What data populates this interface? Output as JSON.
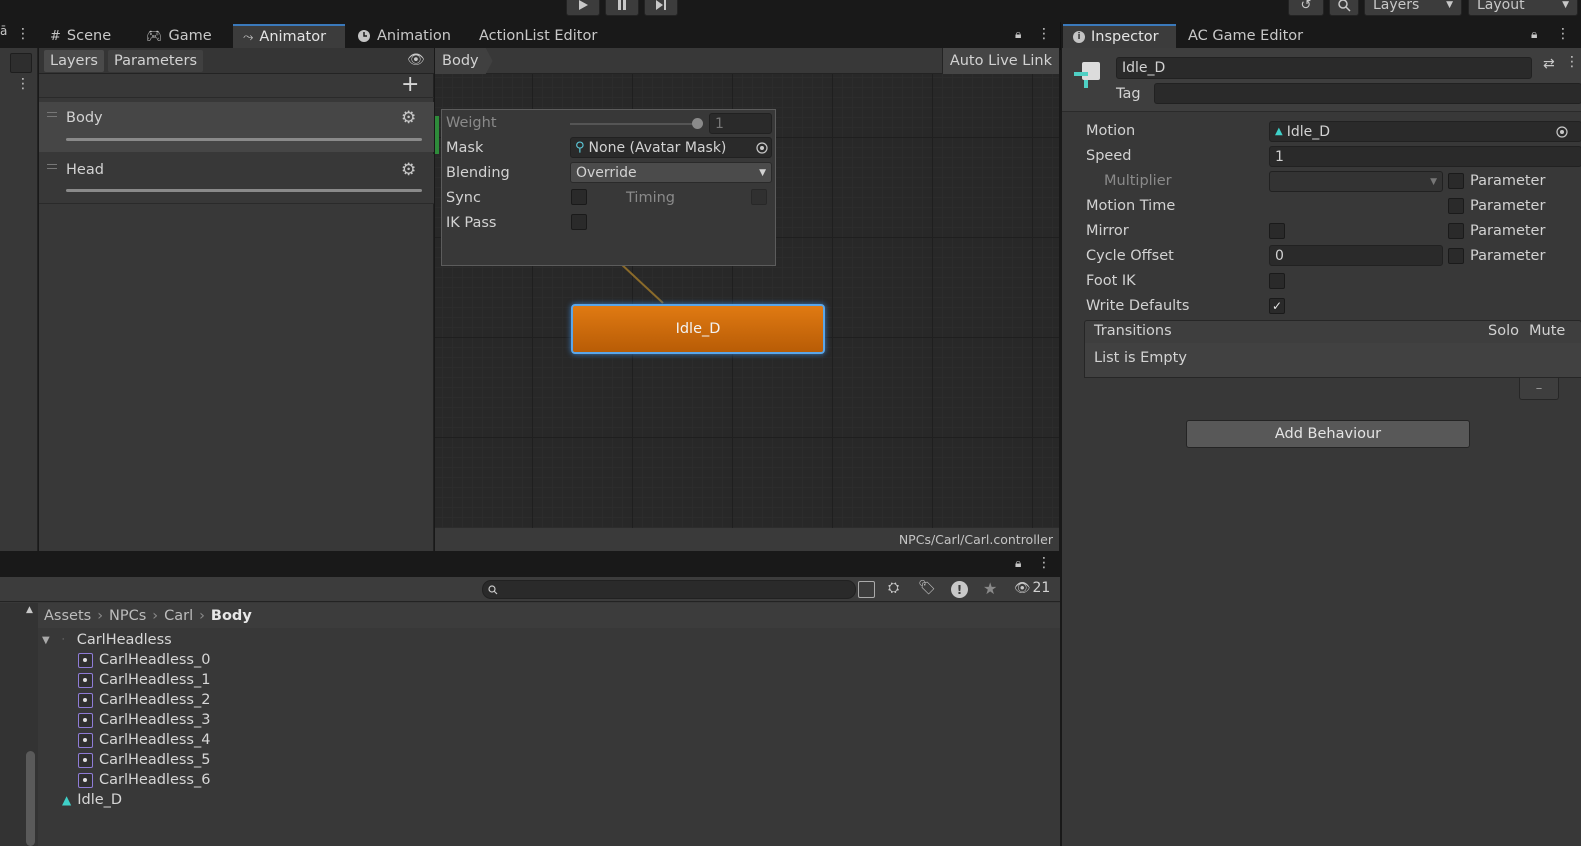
{
  "toolbar": {
    "play_icon": "play-icon",
    "pause_icon": "pause-icon",
    "step_icon": "step-icon",
    "history_icon": "history-icon",
    "search_icon": "search-icon",
    "layers_dropdown": "Layers",
    "layout_dropdown": "Layout"
  },
  "left_tabs": [
    {
      "label": "Scene",
      "icon": "grid-icon"
    },
    {
      "label": "Game",
      "icon": "gamepad-icon"
    },
    {
      "label": "Animator",
      "icon": "animator-icon",
      "active": true
    },
    {
      "label": "Animation",
      "icon": "clock-icon"
    },
    {
      "label": "ActionList Editor"
    }
  ],
  "animator": {
    "subtabs": [
      "Layers",
      "Parameters"
    ],
    "layers": [
      {
        "name": "Body"
      },
      {
        "name": "Head"
      }
    ],
    "breadcrumb": "Body",
    "auto_live_link": "Auto Live Link",
    "layer_settings": {
      "weight_label": "Weight",
      "weight_value": "1",
      "mask_label": "Mask",
      "mask_value": "None (Avatar Mask)",
      "blending_label": "Blending",
      "blending_value": "Override",
      "sync_label": "Sync",
      "timing_label": "Timing",
      "ikpass_label": "IK Pass"
    },
    "state_node": "Idle_D",
    "controller_path": "NPCs/Carl/Carl.controller"
  },
  "project": {
    "search_placeholder": "",
    "hidden_count": "21",
    "breadcrumb": [
      "Assets",
      "NPCs",
      "Carl",
      "Body"
    ],
    "tree_root": "CarlHeadless",
    "sprites": [
      "CarlHeadless_0",
      "CarlHeadless_1",
      "CarlHeadless_2",
      "CarlHeadless_3",
      "CarlHeadless_4",
      "CarlHeadless_5",
      "CarlHeadless_6"
    ],
    "clip": "Idle_D"
  },
  "right_tabs": [
    {
      "label": "Inspector",
      "icon": "info-icon",
      "active": true
    },
    {
      "label": "AC Game Editor"
    }
  ],
  "inspector": {
    "name": "Idle_D",
    "tag_label": "Tag",
    "tag_value": "",
    "motion_label": "Motion",
    "motion_value": "Idle_D",
    "speed_label": "Speed",
    "speed_value": "1",
    "multiplier_label": "Multiplier",
    "parameter_label": "Parameter",
    "motion_time_label": "Motion Time",
    "mirror_label": "Mirror",
    "cycle_offset_label": "Cycle Offset",
    "cycle_offset_value": "0",
    "foot_ik_label": "Foot IK",
    "write_defaults_label": "Write Defaults",
    "write_defaults_checked": true,
    "transitions_label": "Transitions",
    "solo_label": "Solo",
    "mute_label": "Mute",
    "list_empty": "List is Empty",
    "minus": "–",
    "add_behaviour": "Add Behaviour"
  },
  "colors": {
    "state_node": "#d9730e",
    "accent_blue": "#3a79bb",
    "panel": "#383838",
    "grid_bg": "#282828"
  }
}
